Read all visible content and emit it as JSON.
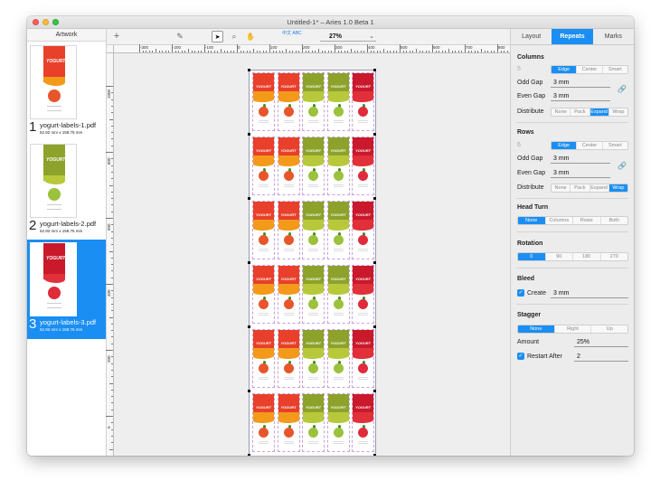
{
  "window": {
    "title": "Untitled-1* – Aries 1.0 Beta 1"
  },
  "sidebar": {
    "header": "Artwork",
    "items": [
      {
        "index": "1",
        "name": "yogurt-labels-1.pdf",
        "size": "52.92 mm x 158.75 mm",
        "flavor": "peach",
        "logo": "YOGURT"
      },
      {
        "index": "2",
        "name": "yogurt-labels-2.pdf",
        "size": "52.92 mm x 158.75 mm",
        "flavor": "apple",
        "logo": "YOGURT"
      },
      {
        "index": "3",
        "name": "yogurt-labels-3.pdf",
        "size": "52.92 mm x 158.75 mm",
        "flavor": "strawberry",
        "logo": "YOGURT"
      }
    ]
  },
  "toolbar": {
    "add": "+",
    "edit": "✎",
    "select": "➤",
    "zoom_tool": "⌕",
    "hand": "✋",
    "text_flow": "中文\nABC",
    "zoom": "27%",
    "zoom_chevron": "⌄"
  },
  "ruler": {
    "h_labels": [
      "-300",
      "-200",
      "-100",
      "0",
      "100",
      "200",
      "300",
      "400",
      "500",
      "600",
      "700",
      "800"
    ],
    "v_labels": [
      "1000",
      "800",
      "600",
      "400",
      "200",
      "0"
    ]
  },
  "label_colors": {
    "peach": {
      "top": "#e8402a",
      "wave": "#f39a1a",
      "fruit": "#e8552b"
    },
    "apple": {
      "top": "#8ca22a",
      "wave": "#b7c93a",
      "fruit": "#9cc13c"
    },
    "strawberry": {
      "top": "#c9192b",
      "wave": "#e2303a",
      "fruit": "#e02b3b"
    }
  },
  "sheet": {
    "columns": [
      "peach",
      "peach",
      "apple",
      "apple",
      "strawberry"
    ],
    "rows": 6,
    "logo": "YOGURT"
  },
  "inspector": {
    "tabs": [
      "Layout",
      "Repeats",
      "Marks"
    ],
    "active_tab": "Repeats",
    "columns": {
      "title": "Columns",
      "count": "5",
      "align": [
        "Edge",
        "Center",
        "Smart"
      ],
      "align_active": "Edge",
      "odd_gap_label": "Odd Gap",
      "odd_gap": "3 mm",
      "even_gap_label": "Even Gap",
      "even_gap": "3 mm",
      "distribute_label": "Distribute",
      "distribute": [
        "None",
        "Pack",
        "Expand",
        "Wrap"
      ],
      "distribute_active": "Expand"
    },
    "rows": {
      "title": "Rows",
      "count": "6",
      "align": [
        "Edge",
        "Center",
        "Smart"
      ],
      "align_active": "Edge",
      "odd_gap_label": "Odd Gap",
      "odd_gap": "3 mm",
      "even_gap_label": "Even Gap",
      "even_gap": "3 mm",
      "distribute_label": "Distribute",
      "distribute": [
        "None",
        "Pack",
        "Expand",
        "Wrap"
      ],
      "distribute_active": "Wrap"
    },
    "head_turn": {
      "title": "Head Turn",
      "options": [
        "None",
        "Columns",
        "Rows",
        "Both"
      ],
      "active": "None"
    },
    "rotation": {
      "title": "Rotation",
      "options": [
        "0",
        "90",
        "180",
        "270"
      ],
      "active": "0"
    },
    "bleed": {
      "title": "Bleed",
      "create_label": "Create",
      "value": "3 mm",
      "checked": true
    },
    "stagger": {
      "title": "Stagger",
      "options": [
        "None",
        "Right",
        "Up"
      ],
      "active": "None",
      "amount_label": "Amount",
      "amount": "25%",
      "restart_label": "Restart After",
      "restart": "2",
      "restart_checked": true
    },
    "check_mark": "✓",
    "link_icon": "🔗"
  }
}
